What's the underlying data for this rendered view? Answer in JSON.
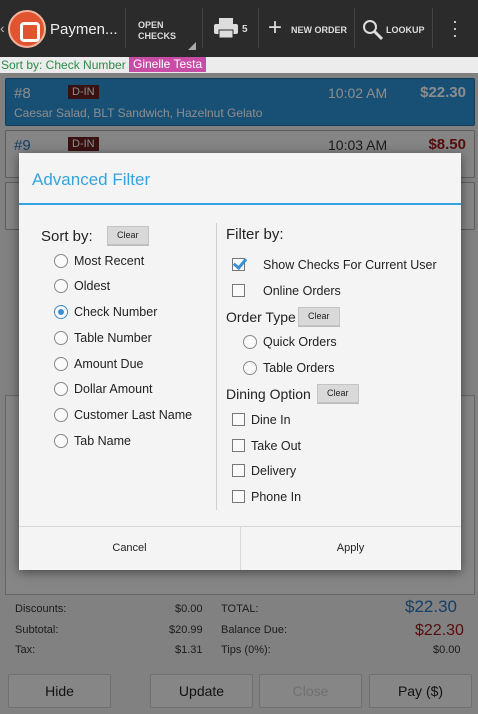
{
  "app": {
    "title": "Paymen...",
    "open_checks": "OPEN\nCHECKS",
    "print_count": "5",
    "new_order": "NEW ORDER",
    "lookup": "LOOKUP"
  },
  "sort_line": {
    "text": "Sort by: Check Number",
    "user": "Ginelle Testa"
  },
  "checks": [
    {
      "num": "#8",
      "dine": "D-IN",
      "time": "10:02 AM",
      "amount": "$22.30",
      "items": "Caesar Salad, BLT Sandwich, Hazelnut Gelato"
    },
    {
      "num": "#9",
      "dine": "D-IN",
      "time": "10:03 AM",
      "amount": "$8.50"
    }
  ],
  "totals": {
    "discounts_label": "Discounts:",
    "discounts": "$0.00",
    "subtotal_label": "Subtotal:",
    "subtotal": "$20.99",
    "tax_label": "Tax:",
    "tax": "$1.31",
    "total_label": "TOTAL:",
    "total": "$22.30",
    "balance_label": "Balance Due:",
    "balance": "$22.30",
    "tips_label": "Tips (0%):",
    "tips": "$0.00"
  },
  "bottom_buttons": {
    "hide": "Hide",
    "update": "Update",
    "close": "Close",
    "pay": "Pay ($)"
  },
  "modal": {
    "title": "Advanced Filter",
    "sort_by": "Sort by:",
    "clear": "Clear",
    "sort_options": [
      "Most Recent",
      "Oldest",
      "Check Number",
      "Table Number",
      "Amount Due",
      "Dollar Amount",
      "Customer Last Name",
      "Tab Name"
    ],
    "sort_selected": "Check Number",
    "filter_by": "Filter by:",
    "show_checks_current_user": "Show Checks For Current User",
    "online_orders": "Online Orders",
    "order_type": "Order Type",
    "order_type_options": [
      "Quick Orders",
      "Table Orders"
    ],
    "dining_option": "Dining Option",
    "dining_options": [
      "Dine In",
      "Take Out",
      "Delivery",
      "Phone In"
    ],
    "cancel": "Cancel",
    "apply": "Apply"
  },
  "colors": {
    "accent": "#35a3dd",
    "selected_check": "#2c93d5",
    "user_badge": "#c84ca5",
    "amount_red": "#a01818"
  }
}
